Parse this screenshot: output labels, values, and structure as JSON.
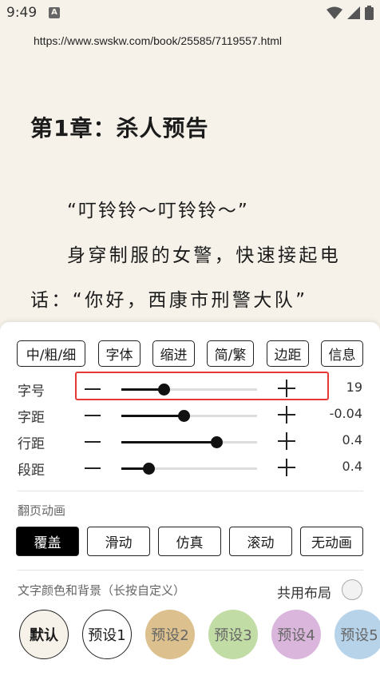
{
  "status_bar": {
    "time": "9:49",
    "notification_letter": "A"
  },
  "url": "https://www.swskw.com/book/25585/7119557.html",
  "chapter": {
    "title": "第1章：杀人预告",
    "paragraphs": [
      "“叮铃铃～叮铃铃～”",
      "身穿制服的女警，快速接起电话：“你好，西康市刑警大队”"
    ]
  },
  "top_options": [
    "中/粗/细",
    "字体",
    "缩进",
    "简/繁",
    "边距",
    "信息"
  ],
  "sliders": [
    {
      "label": "字号",
      "value": "19",
      "fraction": 0.31
    },
    {
      "label": "字距",
      "value": "-0.04",
      "fraction": 0.46
    },
    {
      "label": "行距",
      "value": "0.4",
      "fraction": 0.7
    },
    {
      "label": "段距",
      "value": "0.4",
      "fraction": 0.2
    }
  ],
  "page_animation": {
    "label": "翻页动画",
    "options": [
      "覆盖",
      "滑动",
      "仿真",
      "滚动",
      "无动画"
    ],
    "selected": "覆盖"
  },
  "color_section": {
    "label": "文字颜色和背景（长按自定义）",
    "shared_layout_label": "共用布局",
    "presets": [
      {
        "label": "默认",
        "bg": "#f6f2ea",
        "bold": true
      },
      {
        "label": "预设1",
        "bg": "#ffffff"
      },
      {
        "label": "预设2",
        "bg": "#dcc08d"
      },
      {
        "label": "预设3",
        "bg": "#c2dca5"
      },
      {
        "label": "预设4",
        "bg": "#dab6dc"
      },
      {
        "label": "预设5",
        "bg": "#b6d3ea"
      }
    ]
  },
  "colors": {
    "highlight": "#e53935",
    "panel_bg": "#ffffff",
    "reader_bg": "#f6f2ea"
  }
}
